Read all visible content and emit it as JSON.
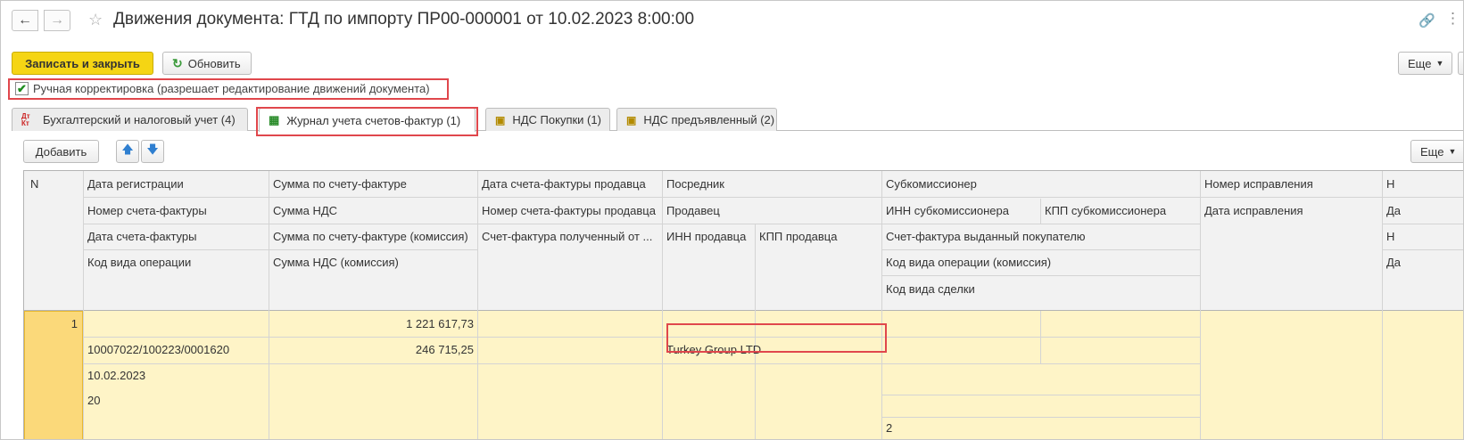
{
  "window": {
    "title": "Движения документа: ГТД по импорту ПР00-000001 от 10.02.2023 8:00:00",
    "back_icon": "arrow-left-icon",
    "forward_icon": "arrow-right-icon",
    "favorite_icon": "star-icon"
  },
  "toolbar": {
    "save_close_label": "Записать и закрыть",
    "refresh_label": "Обновить",
    "more_label": "Еще"
  },
  "manual": {
    "label": "Ручная корректировка (разрешает редактирование движений документа)",
    "checked": true
  },
  "tabs": [
    {
      "label": "Бухгалтерский и налоговый учет (4)",
      "icon": "dt-kt-icon"
    },
    {
      "label": "Журнал учета счетов-фактур (1)",
      "icon": "grid-icon",
      "active": true
    },
    {
      "label": "НДС Покупки (1)",
      "icon": "doc-icon"
    },
    {
      "label": "НДС предъявленный (2)",
      "icon": "doc-icon"
    }
  ],
  "table_toolbar": {
    "add_label": "Добавить",
    "more_label": "Еще"
  },
  "grid": {
    "headers": {
      "n": "N",
      "reg_date": "Дата регистрации",
      "invoice_number": "Номер счета-фактуры",
      "invoice_date": "Дата счета-фактуры",
      "op_code": "Код вида операции",
      "sum_invoice": "Сумма по счету-фактуре",
      "sum_vat": "Сумма НДС",
      "sum_invoice_comm": "Сумма по счету-фактуре (комиссия)",
      "sum_vat_comm": "Сумма НДС (комиссия)",
      "seller_inv_date": "Дата счета-фактуры продавца",
      "seller_inv_number": "Номер счета-фактуры продавца",
      "inv_received_from": "Счет-фактура полученный от ...",
      "intermediary": "Посредник",
      "seller": "Продавец",
      "seller_inn": "ИНН продавца",
      "seller_kpp": "КПП продавца",
      "subcommissioner": "Субкомиссионер",
      "sub_inn": "ИНН субкомиссионера",
      "sub_kpp": "КПП субкомиссионера",
      "inv_issued_to_buyer": "Счет-фактура выданный покупателю",
      "op_code_comm": "Код вида операции (комиссия)",
      "deal_code": "Код вида сделки",
      "correction_number": "Номер исправления",
      "correction_date": "Дата исправления",
      "cut_1": "Н",
      "cut_2": "Да",
      "cut_3": "Н",
      "cut_4": "Да"
    },
    "row": {
      "n": "1",
      "invoice_number": "10007022/100223/0001620",
      "invoice_date": "10.02.2023",
      "op_code": "20",
      "sum_invoice": "1 221 617,73",
      "sum_vat": "246 715,25",
      "seller": "Turkey Group LTD",
      "deal_code": "2"
    }
  }
}
